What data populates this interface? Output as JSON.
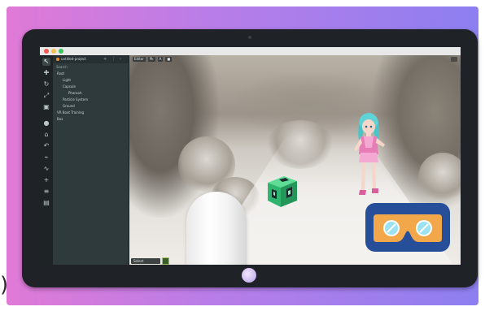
{
  "app": {
    "panel_title": "untitled-project",
    "search_label": "Search"
  },
  "tree": [
    {
      "label": "Root"
    },
    {
      "label": "Light"
    },
    {
      "label": "Capsule"
    },
    {
      "label": "Pharaoh"
    },
    {
      "label": "Particle System"
    },
    {
      "label": "Ground"
    },
    {
      "label": "VR Boot Training"
    },
    {
      "label": "Box"
    }
  ],
  "viewport_toolbar": [
    "Editor",
    "Pk",
    "A",
    "■"
  ],
  "bottom_chip": "Select",
  "colors": {
    "accent": "#f08a24",
    "badge": "#274e99",
    "goggles": "#f2a84a",
    "cube": "#39c27a"
  },
  "icons": {
    "select": "cursor-icon",
    "move": "move-icon",
    "rotate": "rotate-icon",
    "scale": "scale-icon",
    "vr": "vr-goggles-icon"
  }
}
